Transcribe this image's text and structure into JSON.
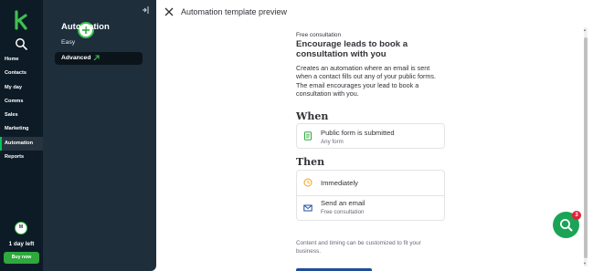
{
  "nav": {
    "items": [
      {
        "label": "Home"
      },
      {
        "label": "Contacts"
      },
      {
        "label": "My day"
      },
      {
        "label": "Comms"
      },
      {
        "label": "Sales"
      },
      {
        "label": "Marketing"
      },
      {
        "label": "Automation",
        "active": true
      },
      {
        "label": "Reports"
      }
    ],
    "avatar_initial": "M",
    "trial_text": "1 day left",
    "buy_label": "Buy now"
  },
  "automation_panel": {
    "title": "Automation",
    "items": [
      "Easy",
      "Advanced"
    ]
  },
  "modal": {
    "title": "Automation template preview",
    "eyebrow": "Free consultation",
    "headline": "Encourage leads to book a consultation with you",
    "description": "Creates an automation where an email is sent when a contact fills out any of your public forms. The email encourages your lead to book a consultation with you.",
    "when": {
      "heading": "When",
      "trigger_title": "Public form is submitted",
      "trigger_sub": "Any form"
    },
    "then": {
      "heading": "Then",
      "step1_title": "Immediately",
      "step2_title": "Send an email",
      "step2_sub": "Free consultation"
    },
    "footnote": "Content and timing can be customized to fit your business."
  },
  "chat": {
    "badge_count": "3"
  },
  "colors": {
    "nav_bg": "#0d1b26",
    "panel_bg": "#1e2e3b",
    "accent_green": "#2fa83d",
    "chat_green": "#1ba456",
    "badge_red": "#e0223c"
  }
}
